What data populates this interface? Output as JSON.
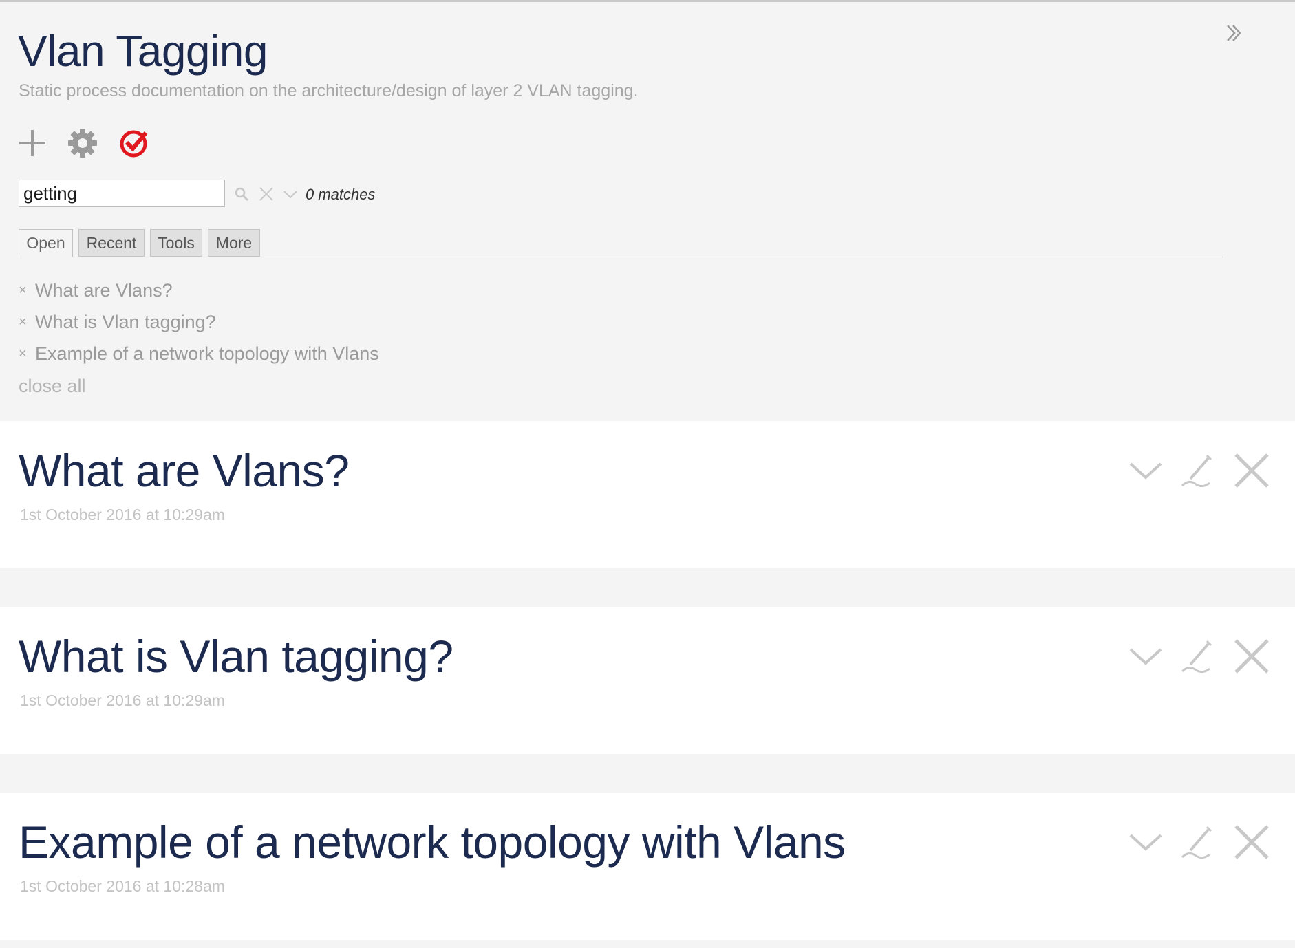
{
  "sidebar": {
    "title": "Vlan Tagging",
    "subtitle": "Static process documentation on the architecture/design of layer 2 VLAN tagging.",
    "toolbar": {
      "new_icon": "plus-icon",
      "control_panel_icon": "gear-icon",
      "save_icon": "check-circle-icon",
      "save_color": "#e0181f"
    },
    "search": {
      "value": "getting",
      "matches_text": "0 matches"
    },
    "tabs": [
      {
        "label": "Open"
      },
      {
        "label": "Recent"
      },
      {
        "label": "Tools"
      },
      {
        "label": "More"
      }
    ],
    "open_items": [
      {
        "close_glyph": "×",
        "label": "What are Vlans?"
      },
      {
        "close_glyph": "×",
        "label": "What is Vlan tagging?"
      },
      {
        "close_glyph": "×",
        "label": "Example of a network topology with Vlans"
      }
    ],
    "close_all_label": "close all"
  },
  "story": {
    "tiddlers": [
      {
        "title": "What are Vlans?",
        "date": "1st October 2016 at 10:29am"
      },
      {
        "title": "What is Vlan tagging?",
        "date": "1st October 2016 at 10:29am"
      },
      {
        "title": "Example of a network topology with Vlans",
        "date": "1st October 2016 at 10:28am"
      }
    ]
  },
  "colors": {
    "title_text": "#1b2a4e",
    "muted_text": "#a6a6a6",
    "icon_gray": "#c8c8c8",
    "background": "#f4f4f4",
    "tiddler_bg": "#ffffff"
  }
}
